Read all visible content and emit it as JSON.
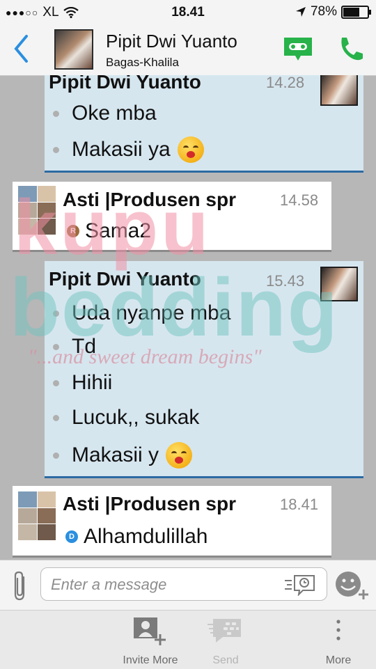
{
  "status_bar": {
    "carrier": "XL",
    "time": "18.41",
    "battery": "78%",
    "battery_level": 0.78
  },
  "header": {
    "back_icon": "chevron-left-icon",
    "contact_name": "Pipit Dwi Yuanto",
    "contact_status": "Bagas-Khalila",
    "video_icon": "voice-video-icon",
    "call_icon": "phone-icon",
    "accent": "#2a8fe0",
    "green": "#27b24a"
  },
  "messages": [
    {
      "side": "in",
      "sender": "Pipit Dwi Yuanto",
      "time": "14.28",
      "lines": [
        {
          "text": "Oke mba",
          "emoji": false
        },
        {
          "text": "Makasii ya",
          "emoji": true
        }
      ]
    },
    {
      "side": "out",
      "sender": "Asti |Produsen spr",
      "time": "14.58",
      "lines": [
        {
          "text": "Sama2",
          "badge": "R"
        }
      ]
    },
    {
      "side": "in",
      "sender": "Pipit Dwi Yuanto",
      "time": "15.43",
      "lines": [
        {
          "text": "Uda nyanpe mba",
          "emoji": false
        },
        {
          "text": "Td",
          "emoji": false
        },
        {
          "text": "Hihii",
          "emoji": false
        },
        {
          "text": "Lucuk,, sukak",
          "emoji": false
        },
        {
          "text": "Makasii y",
          "emoji": true
        }
      ]
    },
    {
      "side": "out",
      "sender": "Asti |Produsen spr",
      "time": "18.41",
      "lines": [
        {
          "text": "Alhamdulillah",
          "badge": "D"
        }
      ]
    }
  ],
  "watermark": {
    "line1": "kupu",
    "line2": "bedding",
    "tagline": "\"...and sweet dream begins\""
  },
  "composer": {
    "attach_icon": "paperclip-icon",
    "placeholder": "Enter a message",
    "timed_icon": "timed-message-icon",
    "emoji_icon": "emoji-add-icon"
  },
  "toolbar": {
    "invite_label": "Invite More",
    "invite_icon": "add-contact-icon",
    "send_label": "Send",
    "send_icon": "send-bbm-icon",
    "more_label": "More",
    "more_icon": "more-vertical-icon"
  }
}
